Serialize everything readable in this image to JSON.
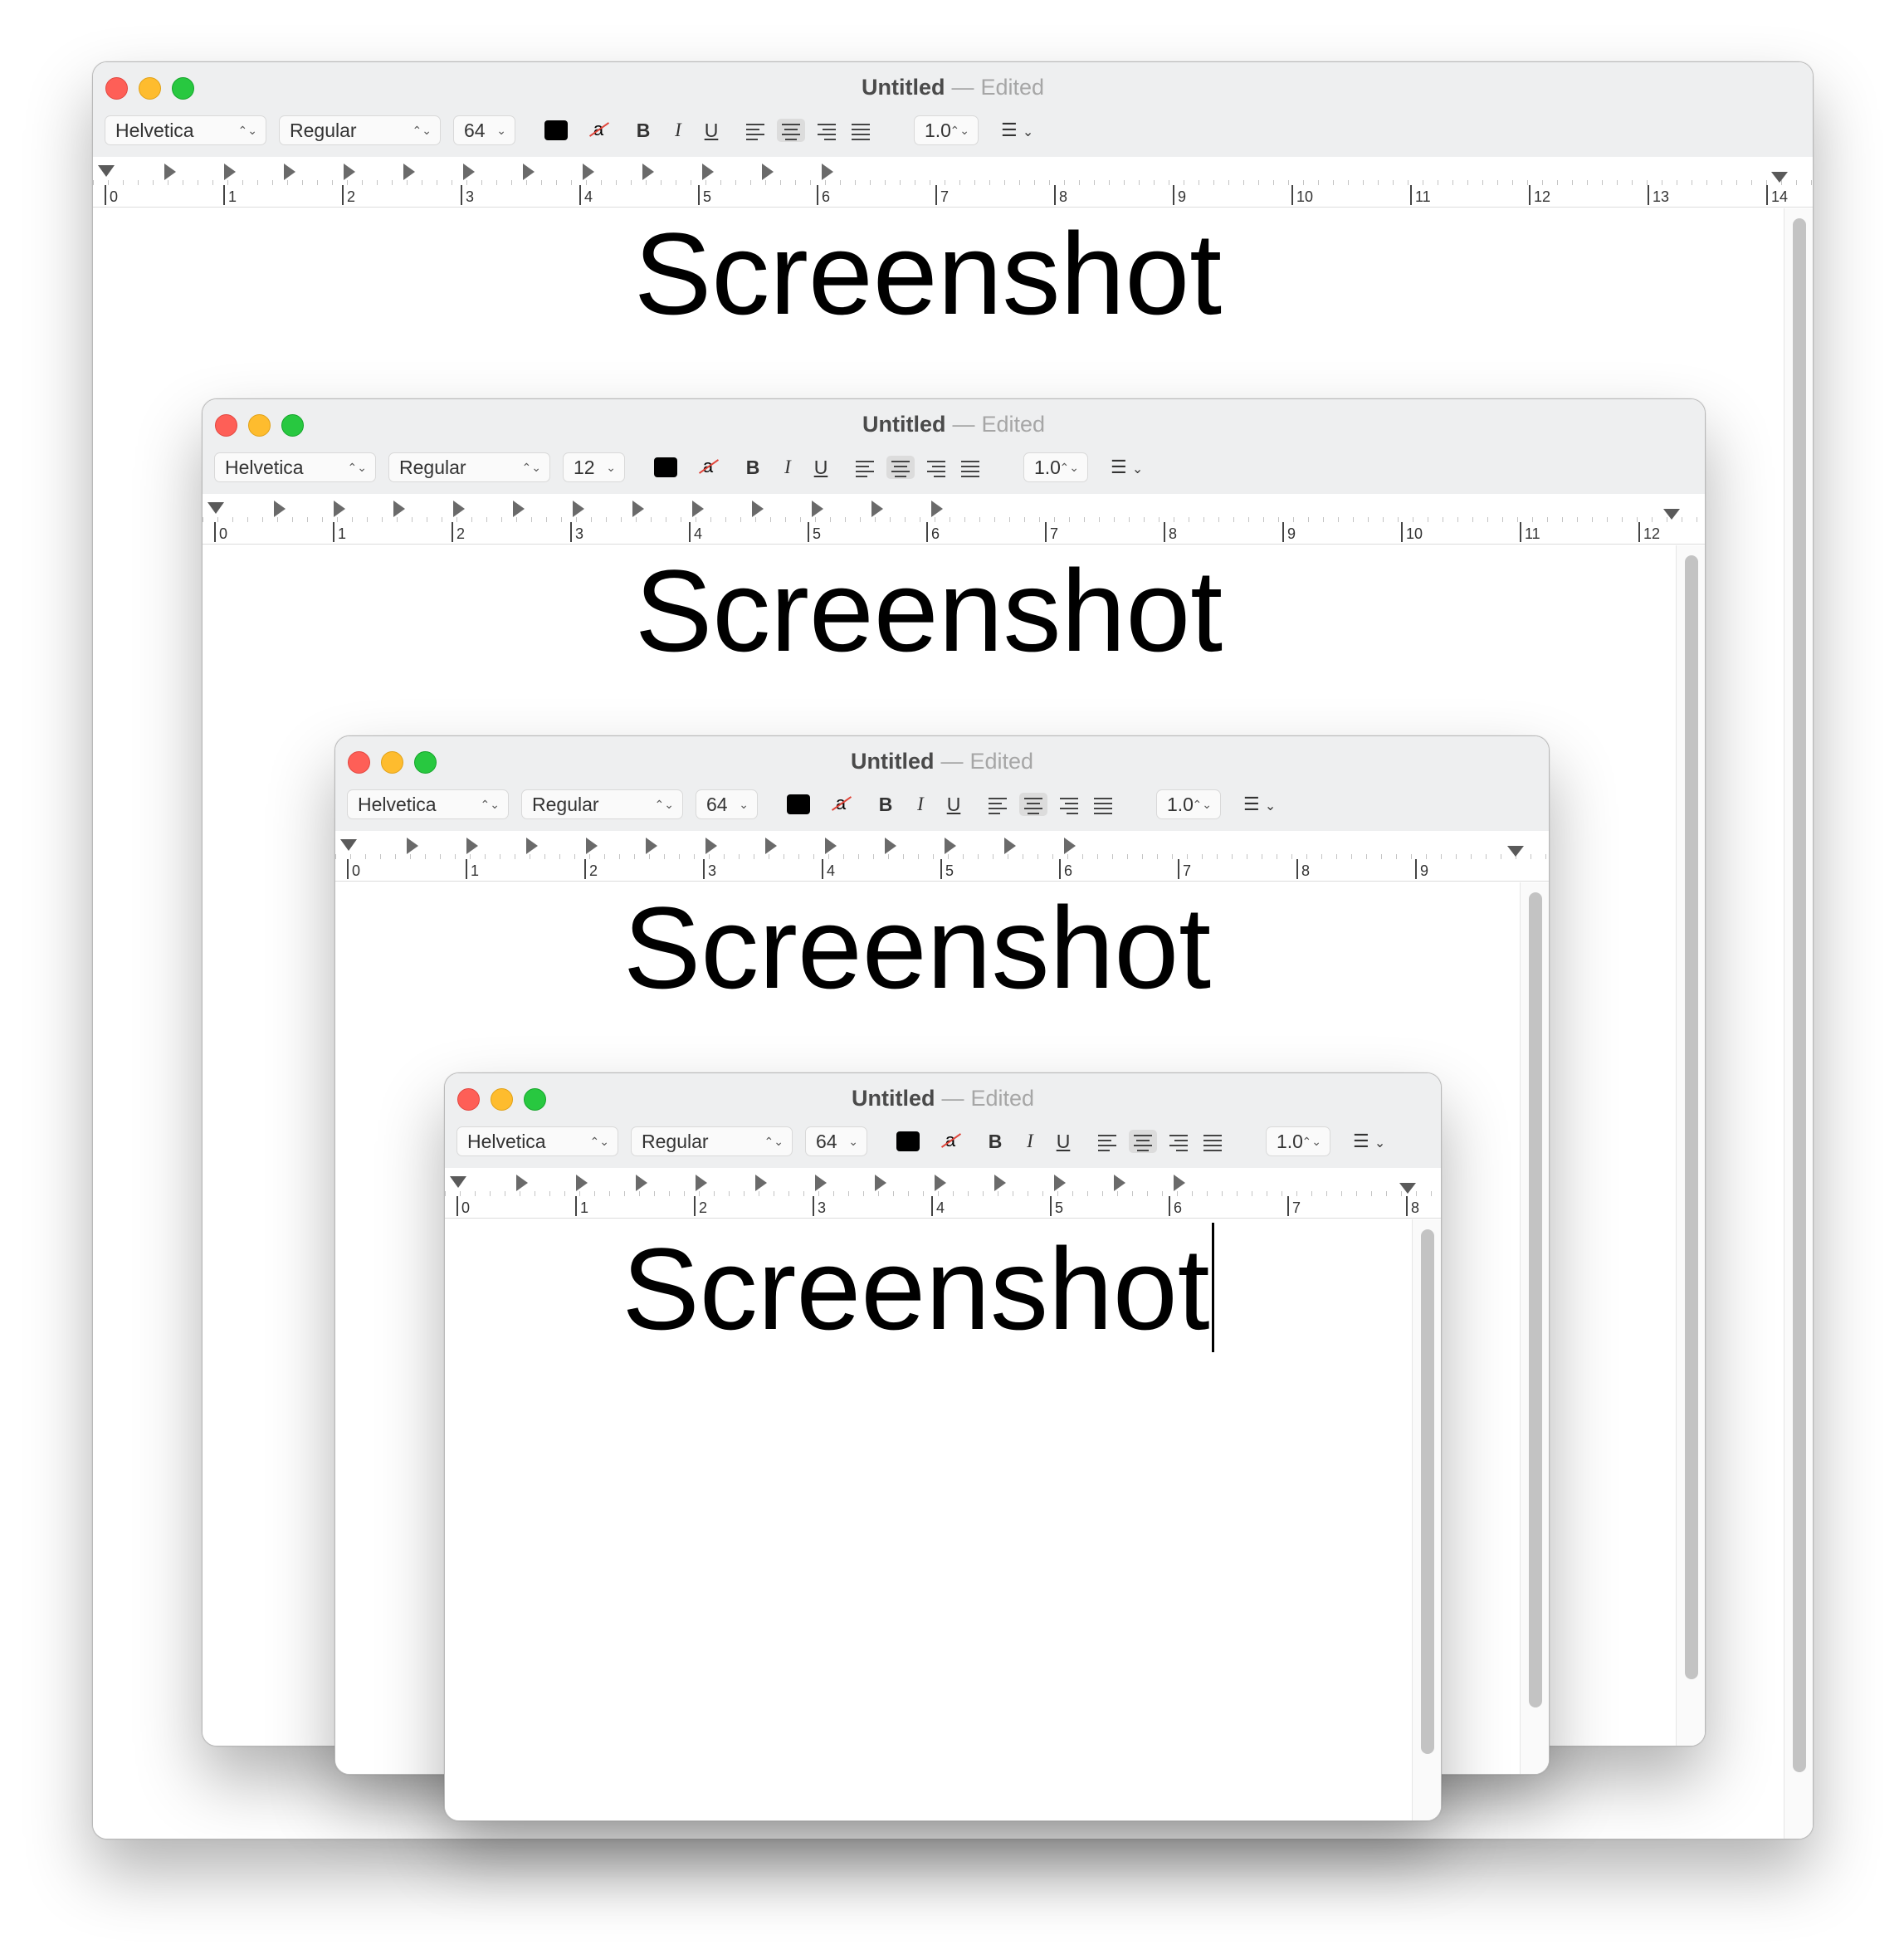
{
  "windows": [
    {
      "title": "Untitled",
      "separator": "—",
      "state": "Edited",
      "font": "Helvetica",
      "style": "Regular",
      "size": "64",
      "line_height": "1.0",
      "document_text": "Screenshot",
      "ruler": [
        "0",
        "1",
        "2",
        "3",
        "4",
        "5",
        "6",
        "7",
        "8",
        "9",
        "10",
        "11",
        "12",
        "13",
        "14"
      ]
    },
    {
      "title": "Untitled",
      "separator": "—",
      "state": "Edited",
      "font": "Helvetica",
      "style": "Regular",
      "size": "12",
      "line_height": "1.0",
      "document_text": "Screenshot",
      "ruler": [
        "0",
        "1",
        "2",
        "3",
        "4",
        "5",
        "6",
        "7",
        "8",
        "9",
        "10",
        "11",
        "12"
      ]
    },
    {
      "title": "Untitled",
      "separator": "—",
      "state": "Edited",
      "font": "Helvetica",
      "style": "Regular",
      "size": "64",
      "line_height": "1.0",
      "document_text": "Screenshot",
      "ruler": [
        "0",
        "1",
        "2",
        "3",
        "4",
        "5",
        "6",
        "7",
        "8",
        "9"
      ]
    },
    {
      "title": "Untitled",
      "separator": "—",
      "state": "Edited",
      "font": "Helvetica",
      "style": "Regular",
      "size": "64",
      "line_height": "1.0",
      "document_text": "Screenshot",
      "ruler": [
        "0",
        "1",
        "2",
        "3",
        "4",
        "5",
        "6",
        "7",
        "8"
      ]
    }
  ],
  "toolbar": {
    "bold": "B",
    "italic": "I",
    "underline": "U",
    "highlight_glyph": "a",
    "list_glyph": "☰",
    "chevron": "⌃⌄",
    "dropdown": "⌄"
  },
  "colors": {
    "close": "#fe5f57",
    "minimize": "#febc2e",
    "zoom": "#28c840",
    "text_color_swatch": "#000000"
  }
}
